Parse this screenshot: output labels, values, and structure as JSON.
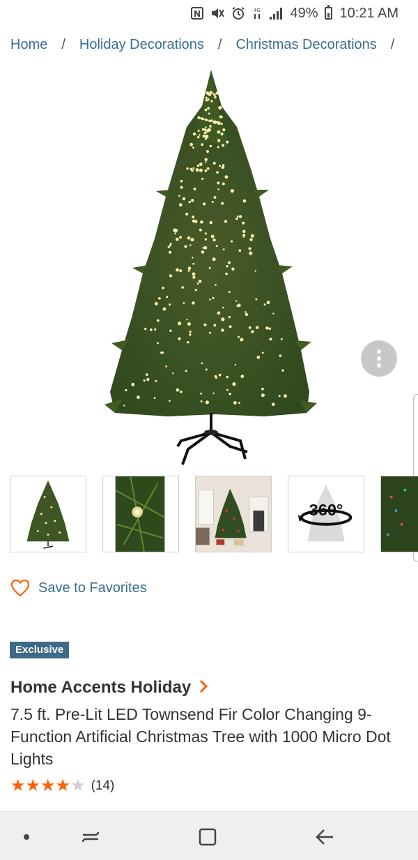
{
  "status_bar": {
    "battery": "49%",
    "time": "10:21 AM",
    "icons": [
      "nfc-icon",
      "mute-icon",
      "alarm-icon",
      "lte-icon",
      "signal-icon",
      "battery-icon"
    ]
  },
  "breadcrumb": [
    "Home",
    "Holiday Decorations",
    "Christmas Decorations"
  ],
  "gallery": {
    "thumb_360_label": "360°"
  },
  "favorites_label": "Save to Favorites",
  "badge": "Exclusive",
  "brand": "Home Accents Holiday",
  "product_title": "7.5 ft. Pre-Lit LED Townsend Fir Color Changing 9-Function Artificial Christmas Tree with 1000 Micro Dot Lights",
  "rating": {
    "stars": 4,
    "max": 5,
    "count": "(14)"
  },
  "colors": {
    "link": "#3a6f8f",
    "accent_orange": "#f96302",
    "badge_blue": "#3d6a86"
  }
}
